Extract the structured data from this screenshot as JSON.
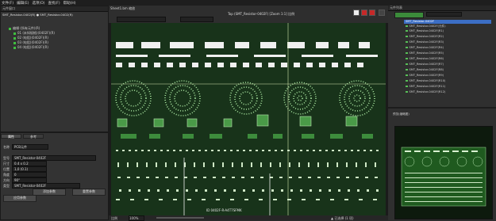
{
  "menubar": {
    "items": [
      "文件(F)",
      "编辑(E)",
      "选项(O)",
      "查找(F)",
      "帮助(H)"
    ]
  },
  "tree_panel": {
    "title": "元件窗口",
    "path": "SMT_Resistor-0402(R) ● SMT_Resistor-0402(R)",
    "items": [
      {
        "label": "编辑 (所有元件)(R)"
      },
      {
        "label": "01 (未知规格)(0402F)(R)"
      },
      {
        "label": "02 (电阻)(0402F)(R)"
      },
      {
        "label": "03 (电阻)(0402F)(R)"
      },
      {
        "label": "04 (电阻)(0402F)(R)"
      }
    ]
  },
  "props_panel": {
    "tabs": [
      "属性",
      "参考"
    ],
    "rows": [
      {
        "label": "名称",
        "value": "PCB元件"
      },
      {
        "label": "型号",
        "value": "SMT_Resistor-0402F"
      },
      {
        "label": "尺寸",
        "value": "0.4 x 0.2"
      },
      {
        "label": "位置",
        "value": "1,0 (0.1)"
      },
      {
        "label": "角度",
        "value": "0"
      },
      {
        "label": "方向",
        "value": "90°"
      },
      {
        "label": "类型",
        "value": "SMT_Resistor-0402F"
      }
    ],
    "buttons": [
      "添加参数",
      "重置参数",
      "应用参数"
    ]
  },
  "center": {
    "toolbar_left": "Sheet1.bm 缩放",
    "toolbar_center": "Top (SMT_Resistor-0402F) [Zoom 1:1] 比例",
    "canvas_status": "ID 0402F-R-A4T7SFMK",
    "status_left": "比例",
    "status_zoom": "100%",
    "status_right": "▲ 已选择 (1 项)"
  },
  "right_panel": {
    "title": "元件列表",
    "search_placeholder": "搜索",
    "selected": "SMT_Resistor-0402F",
    "items": [
      "SMT_Resistor-0402F(元件)",
      "SMT_Resistor-0402F(R1)",
      "SMT_Resistor-0402F(R2)",
      "SMT_Resistor-0402F(R3)",
      "SMT_Resistor-0402F(R4)",
      "SMT_Resistor-0402F(R5)",
      "SMT_Resistor-0402F(R6)",
      "SMT_Resistor-0402F(R7)",
      "SMT_Resistor-0402F(R8)",
      "SMT_Resistor-0402F(R9)",
      "SMT_Resistor-0402F(R10)",
      "SMT_Resistor-0402F(R11)",
      "SMT_Resistor-0402F(R12)"
    ],
    "preview_title": "预览(缩略图)"
  }
}
